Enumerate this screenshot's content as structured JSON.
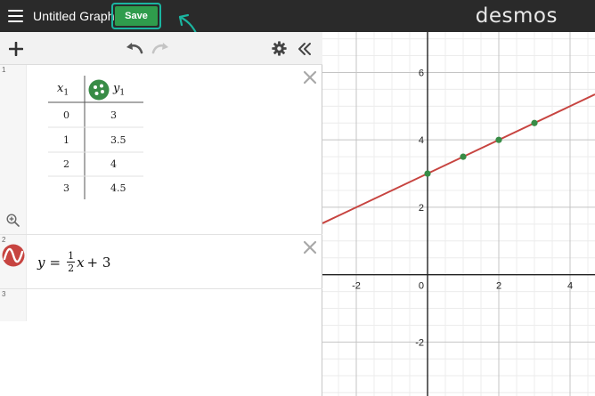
{
  "header": {
    "graph_title": "Untitled Graph",
    "save_label": "Save",
    "brand": "desmos"
  },
  "expressions": {
    "row1": {
      "index": "1",
      "table": {
        "col_x_var": "x",
        "col_x_sub": "1",
        "col_y_var": "y",
        "col_y_sub": "1",
        "rows": [
          {
            "x": "0",
            "y": "3"
          },
          {
            "x": "1",
            "y": "3.5"
          },
          {
            "x": "2",
            "y": "4"
          },
          {
            "x": "3",
            "y": "4.5"
          }
        ]
      }
    },
    "row2": {
      "index": "2",
      "lhs": "y",
      "eq": "=",
      "num": "1",
      "den": "2",
      "var": "x",
      "tail": "+ 3"
    },
    "row3": {
      "index": "3"
    }
  },
  "graph": {
    "x_ticks": [
      "-2",
      "0",
      "2",
      "4"
    ],
    "y_ticks": [
      "6",
      "4",
      "2",
      "-2"
    ],
    "xlim": [
      -2.95,
      4.7
    ],
    "ylim": [
      -3.6,
      7.2
    ],
    "line": {
      "slope": 0.5,
      "intercept": 3,
      "color": "#c74440"
    },
    "points": [
      [
        0,
        3
      ],
      [
        1,
        3.5
      ],
      [
        2,
        4
      ],
      [
        3,
        4.5
      ]
    ],
    "point_color": "#388c46"
  },
  "colors": {
    "topbar": "#2a2a2a",
    "save": "#2f9c4c",
    "accent_teal": "#1bb5a0",
    "line_red": "#c74440",
    "point_green": "#388c46"
  },
  "icons": {
    "menu": "hamburger-menu-icon",
    "add": "plus-icon",
    "undo": "undo-icon",
    "redo": "redo-icon",
    "settings": "gear-icon",
    "collapse": "double-chevron-left-icon",
    "zoom_fit": "magnifier-plus-icon",
    "delete": "close-icon"
  }
}
